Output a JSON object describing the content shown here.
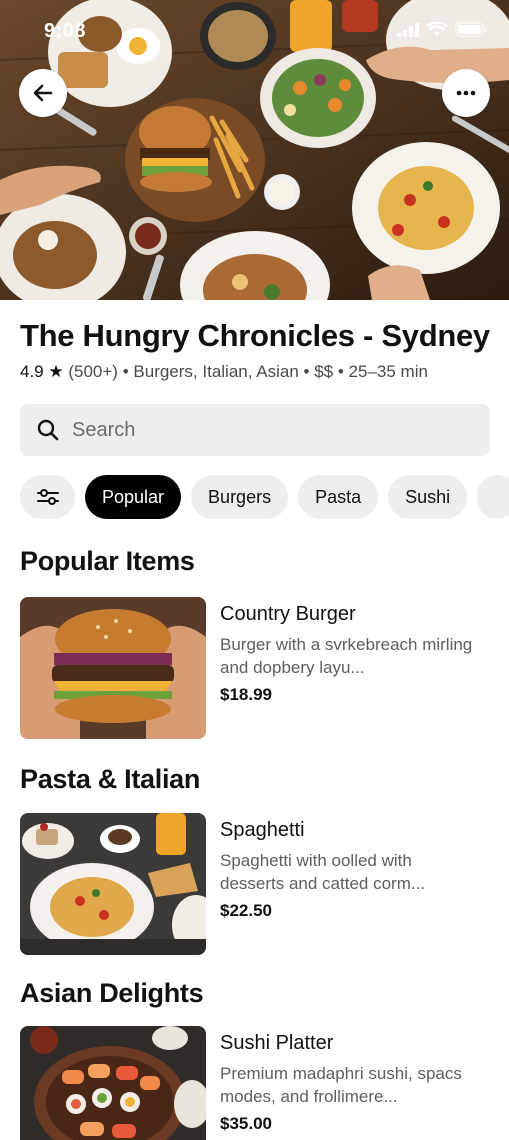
{
  "status_bar": {
    "time": "9:08"
  },
  "hero": {
    "image": "food-table-photo"
  },
  "restaurant": {
    "name": "The Hungry Chronicles - Sydney",
    "rating": "4.9",
    "reviews": "(500+)",
    "cuisines": "Burgers, Italian, Asian",
    "price_level": "$$",
    "delivery_time": "25–35 min"
  },
  "search": {
    "placeholder": "Search"
  },
  "chips": [
    {
      "label": "Popular",
      "active": true
    },
    {
      "label": "Burgers",
      "active": false
    },
    {
      "label": "Pasta",
      "active": false
    },
    {
      "label": "Sushi",
      "active": false
    }
  ],
  "sections": [
    {
      "title": "Popular Items",
      "items": [
        {
          "name": "Country Burger",
          "description": "Burger with a svrkebreach mirling and dopbery layu...",
          "price": "$18.99"
        }
      ]
    },
    {
      "title": "Pasta & Italian",
      "items": [
        {
          "name": "Spaghetti",
          "description": "Spaghetti with oolled with desserts and catted corm...",
          "price": "$22.50"
        }
      ]
    },
    {
      "title": "Asian Delights",
      "items": [
        {
          "name": "Sushi Platter",
          "description": "Premium madaphri sushi, spacs modes, and frollimere...",
          "price": "$35.00"
        }
      ]
    }
  ],
  "colors": {
    "accent": "#000000",
    "chip_bg": "#eeeeee",
    "search_bg": "#eeeeee",
    "muted_text": "#5e5e5e"
  }
}
